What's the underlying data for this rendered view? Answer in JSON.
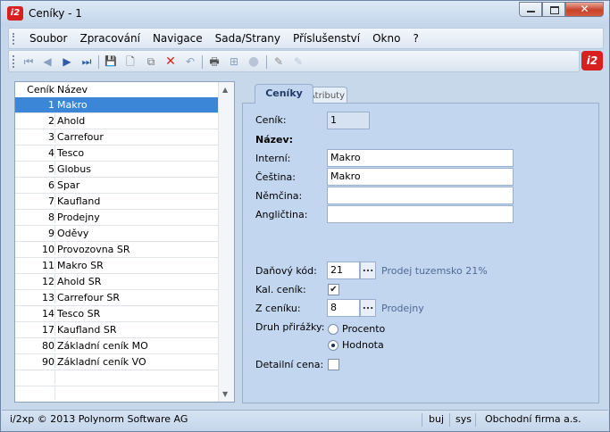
{
  "window": {
    "title": "Ceníky - 1",
    "app_badge": "i2",
    "minimize_icon": "minimize-icon",
    "maximize_icon": "maximize-icon",
    "close_glyph": "✕"
  },
  "menu": [
    "Soubor",
    "Zpracování",
    "Navigace",
    "Sada/Strany",
    "Příslušenství",
    "Okno",
    "?"
  ],
  "toolbar": {
    "icons": [
      "first-record-icon",
      "previous-record-icon",
      "next-record-icon",
      "last-record-icon",
      "save-icon",
      "new-icon",
      "copy-icon",
      "delete-icon",
      "undo-icon",
      "print-icon",
      "tree-icon",
      "disabled-circle-icon",
      "edit-pen-icon",
      "edit-pen-disabled-icon"
    ],
    "glyphs": [
      "⏮",
      "◀",
      "▶",
      "⏭",
      "💾",
      "🗋",
      "⧉",
      "✕",
      "↶",
      "🖶",
      "⊞",
      "●",
      "✎",
      "✎"
    ]
  },
  "list": {
    "headers": {
      "id": "Ceník",
      "name": "Název"
    },
    "rows": [
      {
        "id": "1",
        "name": "Makro",
        "selected": true
      },
      {
        "id": "2",
        "name": "Ahold"
      },
      {
        "id": "3",
        "name": "Carrefour"
      },
      {
        "id": "4",
        "name": "Tesco"
      },
      {
        "id": "5",
        "name": "Globus"
      },
      {
        "id": "6",
        "name": "Spar"
      },
      {
        "id": "7",
        "name": "Kaufland"
      },
      {
        "id": "8",
        "name": "Prodejny"
      },
      {
        "id": "9",
        "name": "Oděvy"
      },
      {
        "id": "10",
        "name": "Provozovna SR"
      },
      {
        "id": "11",
        "name": "Makro SR"
      },
      {
        "id": "12",
        "name": "Ahold SR"
      },
      {
        "id": "13",
        "name": "Carrefour SR"
      },
      {
        "id": "14",
        "name": "Tesco SR"
      },
      {
        "id": "17",
        "name": "Kaufland SR"
      },
      {
        "id": "80",
        "name": "Základní ceník MO"
      },
      {
        "id": "90",
        "name": "Základní ceník VO"
      },
      {
        "id": "",
        "name": ""
      },
      {
        "id": "",
        "name": ""
      },
      {
        "id": "",
        "name": ""
      }
    ]
  },
  "tabs": {
    "active": "Ceníky",
    "inactive": "Atributy"
  },
  "form": {
    "cenik_label": "Ceník:",
    "cenik_value": "1",
    "nazev_label": "Název:",
    "interni_label": "Interní:",
    "interni_value": "Makro",
    "cestina_label": "Čeština:",
    "cestina_value": "Makro",
    "nemcina_label": "Němčina:",
    "nemcina_value": "",
    "anglictina_label": "Angličtina:",
    "anglictina_value": "",
    "danovy_kod_label": "Daňový kód:",
    "danovy_kod_value": "21",
    "danovy_kod_hint": "Prodej tuzemsko 21%",
    "kal_cenik_label": "Kal. ceník:",
    "kal_cenik_checked": true,
    "z_ceniku_label": "Z ceníku:",
    "z_ceniku_value": "8",
    "z_ceniku_hint": "Prodejny",
    "druh_label": "Druh přirážky:",
    "radio_procento": "Procento",
    "radio_hodnota": "Hodnota",
    "radio_selected": "Hodnota",
    "detailni_label": "Detailní cena:",
    "detailni_checked": false,
    "dots": "..."
  },
  "status": {
    "copyright": "i/2xp © 2013 Polynorm Software AG",
    "user": "buj",
    "db": "sys",
    "company": "Obchodní firma a.s."
  }
}
